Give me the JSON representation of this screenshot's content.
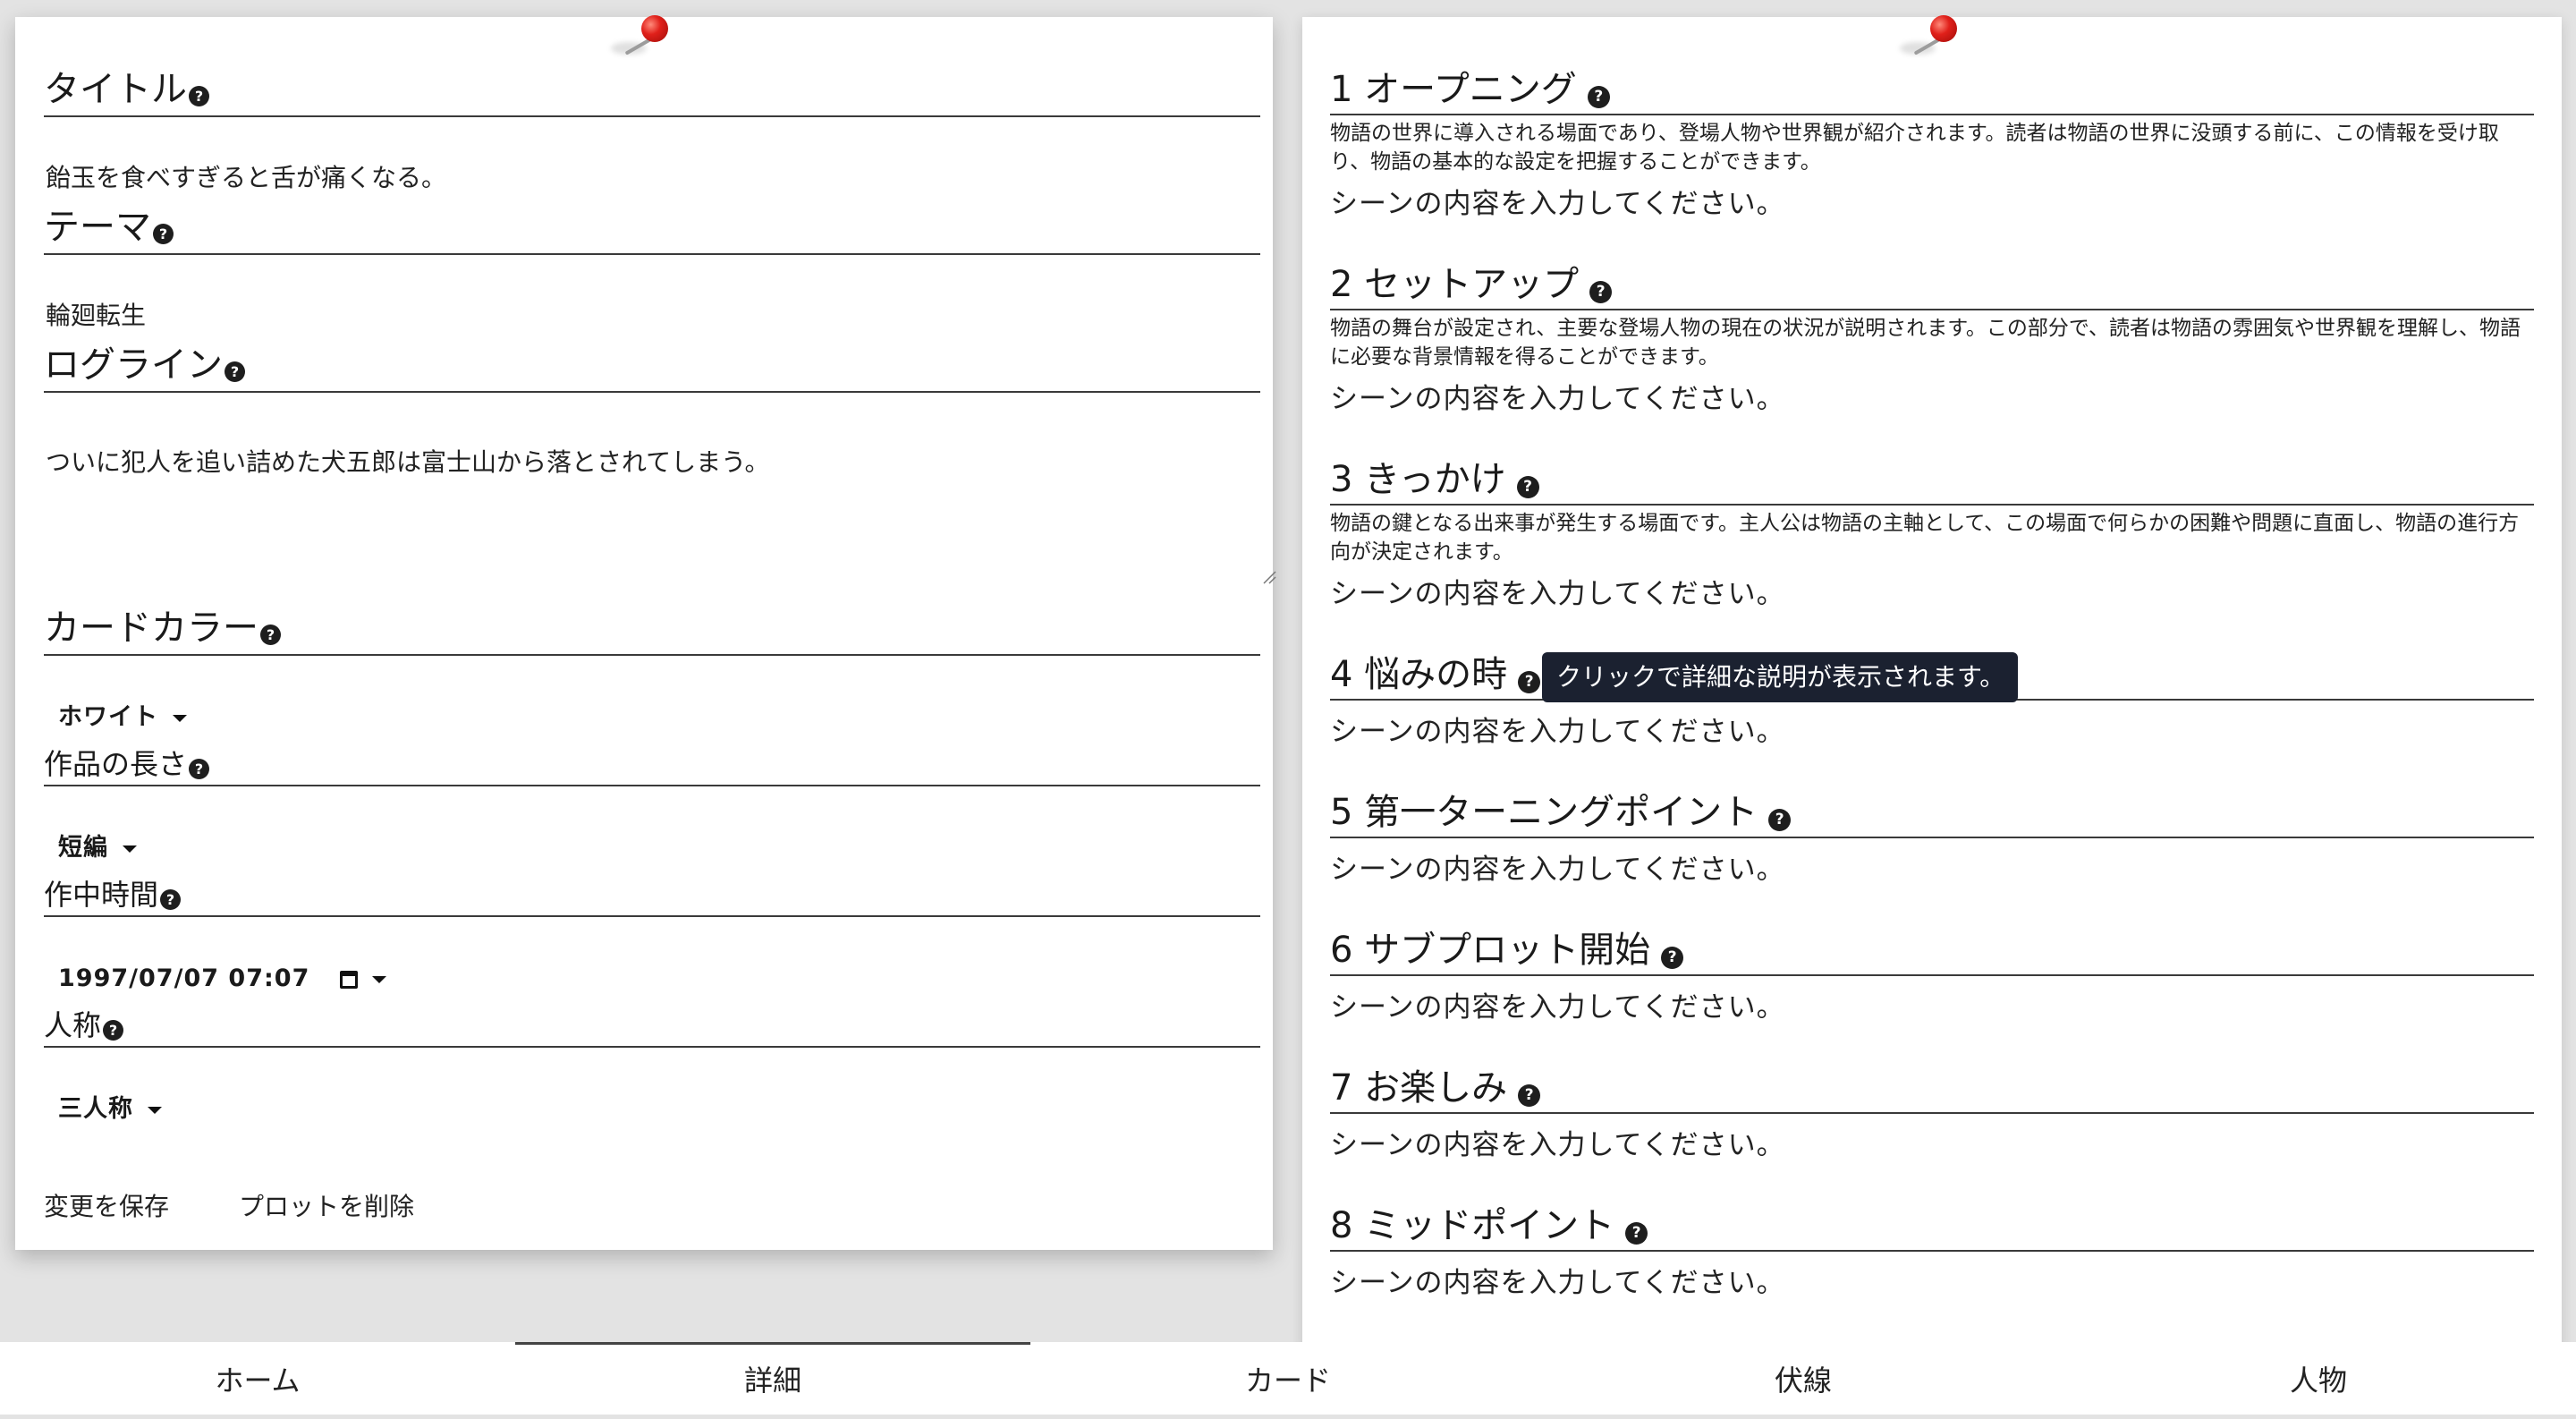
{
  "left": {
    "title_label": "タイトル",
    "title_value": "飴玉を食べすぎると舌が痛くなる。",
    "theme_label": "テーマ",
    "theme_value": "輪廻転生",
    "logline_label": "ログライン",
    "logline_value": "ついに犯人を追い詰めた犬五郎は富士山から落とされてしまう。",
    "card_color_label": "カードカラー",
    "card_color_value": "ホワイト",
    "length_label": "作品の長さ",
    "length_value": "短編",
    "time_label": "作中時間",
    "time_value": "1997/07/07 07:07",
    "person_label": "人称",
    "person_value": "三人称",
    "save_label": "変更を保存",
    "delete_label": "プロットを削除"
  },
  "help_glyph": "?",
  "scenes": [
    {
      "title": "1 オープニング",
      "desc": "物語の世界に導入される場面であり、登場人物や世界観が紹介されます。読者は物語の世界に没頭する前に、この情報を受け取り、物語の基本的な設定を把握することができます。",
      "placeholder": "シーンの内容を入力してください。"
    },
    {
      "title": "2 セットアップ",
      "desc": "物語の舞台が設定され、主要な登場人物の現在の状況が説明されます。この部分で、読者は物語の雰囲気や世界観を理解し、物語に必要な背景情報を得ることができます。",
      "placeholder": "シーンの内容を入力してください。"
    },
    {
      "title": "3 きっかけ",
      "desc": "物語の鍵となる出来事が発生する場面です。主人公は物語の主軸として、この場面で何らかの困難や問題に直面し、物語の進行方向が決定されます。",
      "placeholder": "シーンの内容を入力してください。"
    },
    {
      "title": "4 悩みの時",
      "desc": "",
      "placeholder": "シーンの内容を入力してください。"
    },
    {
      "title": "5 第一ターニングポイント",
      "desc": "",
      "placeholder": "シーンの内容を入力してください。"
    },
    {
      "title": "6 サブプロット開始",
      "desc": "",
      "placeholder": "シーンの内容を入力してください。"
    },
    {
      "title": "7 お楽しみ",
      "desc": "",
      "placeholder": "シーンの内容を入力してください。"
    },
    {
      "title": "8 ミッドポイント",
      "desc": "",
      "placeholder": "シーンの内容を入力してください。"
    }
  ],
  "tooltip": "クリックで詳細な説明が表示されます。",
  "tabs": [
    {
      "label": "ホーム",
      "active": false
    },
    {
      "label": "詳細",
      "active": true
    },
    {
      "label": "カード",
      "active": false
    },
    {
      "label": "伏線",
      "active": false
    },
    {
      "label": "人物",
      "active": false
    }
  ],
  "colors": {
    "pin": "#e0201a",
    "tooltip_bg": "#1b2130",
    "background": "#e3e3e3"
  },
  "icons": {
    "help": "question-circle-icon",
    "pin": "pushpin-icon",
    "calendar": "calendar-icon",
    "caret": "caret-down-icon"
  }
}
